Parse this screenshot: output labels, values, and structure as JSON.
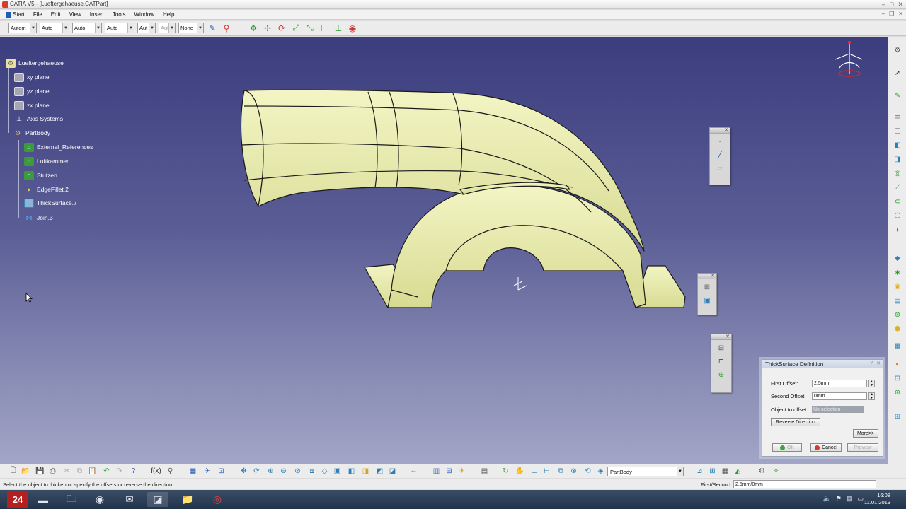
{
  "window": {
    "title": "CATIA V5 - [Lueftergehaeuse.CATPart]"
  },
  "menu": [
    "Start",
    "File",
    "Edit",
    "View",
    "Insert",
    "Tools",
    "Window",
    "Help"
  ],
  "toolbar_top": {
    "combos": [
      "Autom",
      "Auto",
      "Auto",
      "Auto",
      "Aut",
      "Aut",
      "None"
    ]
  },
  "tree": {
    "root": "Lueftergehaeuse",
    "items": [
      {
        "label": "xy plane",
        "icon": "plane-icon"
      },
      {
        "label": "yz plane",
        "icon": "plane-icon"
      },
      {
        "label": "zx plane",
        "icon": "plane-icon"
      },
      {
        "label": "Axis Systems",
        "icon": "axis-system-icon"
      },
      {
        "label": "PartBody",
        "icon": "partbody-icon"
      },
      {
        "label": "External_References",
        "icon": "feature-icon"
      },
      {
        "label": "Luftkammer",
        "icon": "feature-icon"
      },
      {
        "label": "Stutzen",
        "icon": "feature-icon"
      },
      {
        "label": "EdgeFillet.2",
        "icon": "fillet-icon"
      },
      {
        "label": "ThickSurface.7",
        "icon": "thicksurface-icon"
      },
      {
        "label": "Join.3",
        "icon": "join-icon"
      }
    ]
  },
  "dialog": {
    "title": "ThickSurface Definition",
    "first_offset_label": "First Offset:",
    "first_offset_value": "2.5mm",
    "second_offset_label": "Second Offset:",
    "second_offset_value": "0mm",
    "object_label": "Object to offset:",
    "object_value": "No selection",
    "reverse_label": "Reverse Direction",
    "more_label": "More>>",
    "ok_label": "OK",
    "cancel_label": "Cancel",
    "preview_label": "Preview"
  },
  "bottom_toolbar": {
    "body_combo": "PartBody"
  },
  "status": {
    "message": "Select the object to thicken or specify the offsets or reverse the direction.",
    "input_label": "First/Second",
    "input_value": "2.5mm/0mm"
  },
  "taskbar": {
    "start_label": "24",
    "time": "16:08",
    "date": "11.01.2013"
  },
  "colors": {
    "viewport_top": "#3b3d7e",
    "viewport_bottom": "#a2a5c6",
    "part_fill": "#e5e8a8",
    "part_edge": "#1a1a1a",
    "accent_green": "#2a9a2a"
  }
}
